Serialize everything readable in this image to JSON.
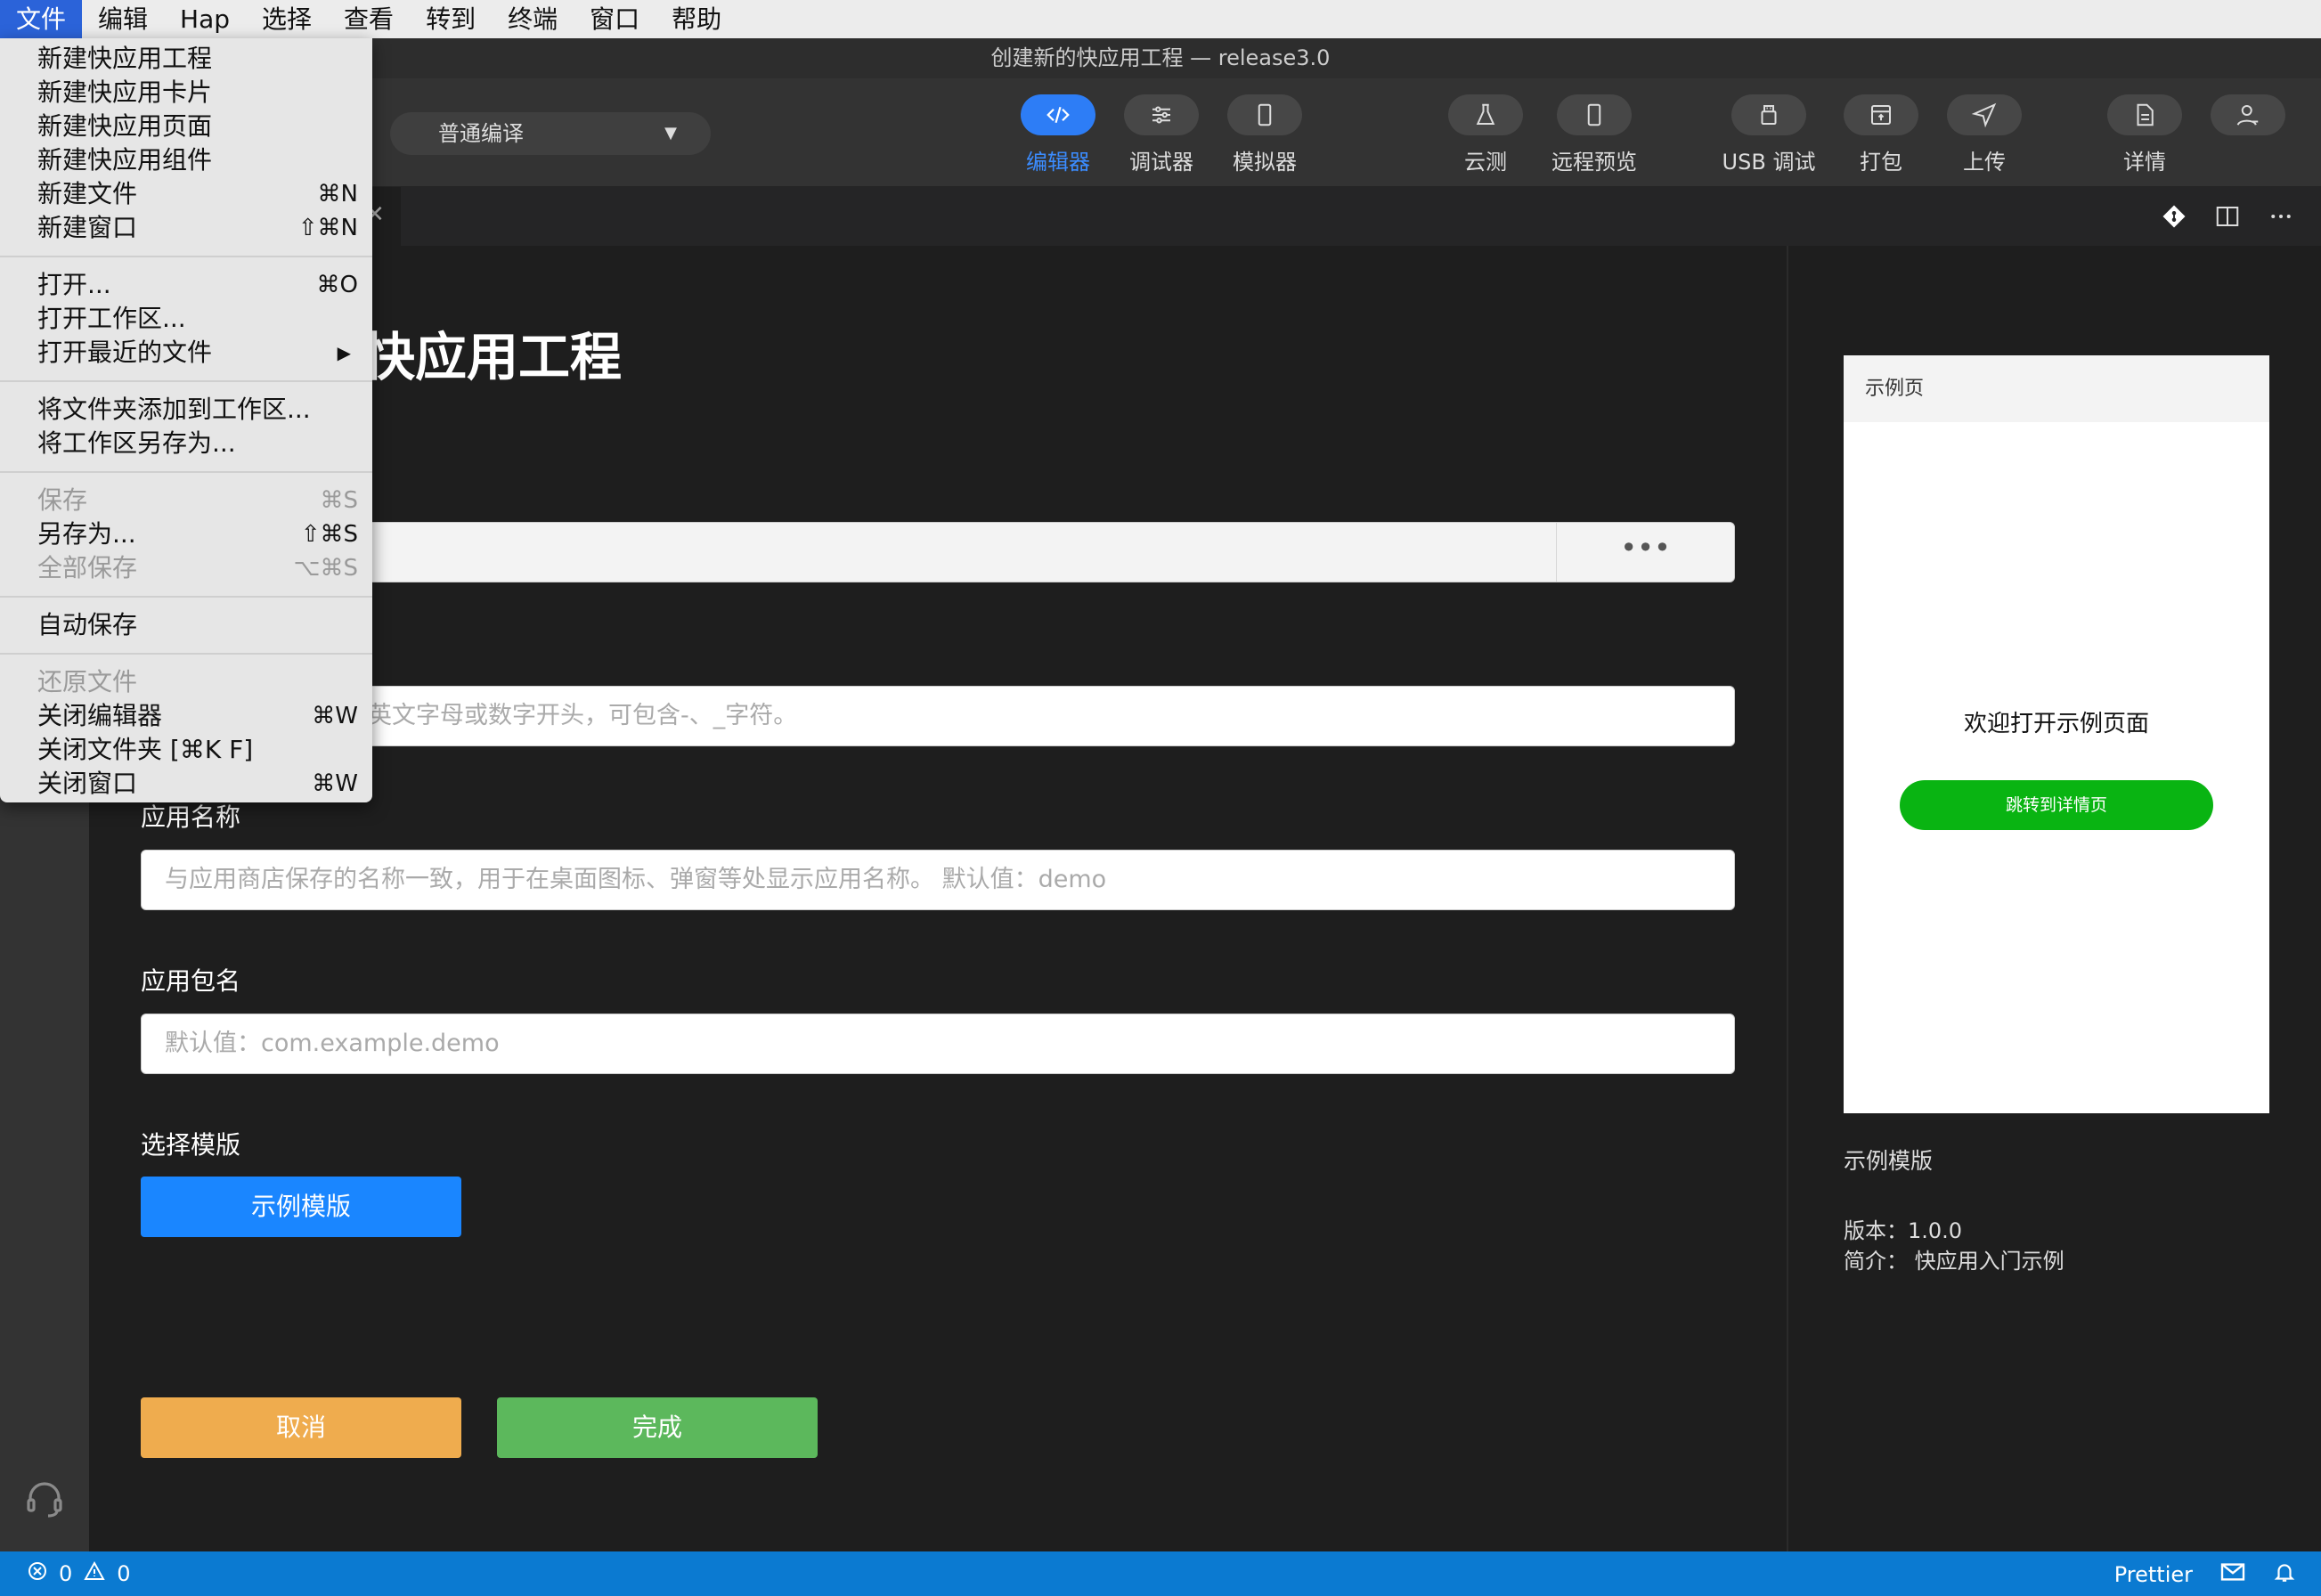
{
  "menubar": {
    "items": [
      "文件",
      "编辑",
      "Hap",
      "选择",
      "查看",
      "转到",
      "终端",
      "窗口",
      "帮助"
    ]
  },
  "window": {
    "title": "创建新的快应用工程 — release3.0"
  },
  "toolbar": {
    "compile_mode": "普通编译",
    "buttons": [
      {
        "label": "编辑器",
        "icon": "code-icon"
      },
      {
        "label": "调试器",
        "icon": "sliders-icon"
      },
      {
        "label": "模拟器",
        "icon": "phone-icon"
      },
      {
        "label": "云测",
        "icon": "flask-icon"
      },
      {
        "label": "远程预览",
        "icon": "phone-icon"
      },
      {
        "label": "USB 调试",
        "icon": "usb-icon"
      },
      {
        "label": "打包",
        "icon": "package-icon"
      },
      {
        "label": "上传",
        "icon": "send-icon"
      },
      {
        "label": "详情",
        "icon": "document-icon"
      }
    ]
  },
  "file_menu": {
    "group1": [
      {
        "label": "新建快应用工程",
        "shortcut": ""
      },
      {
        "label": "新建快应用卡片",
        "shortcut": ""
      },
      {
        "label": "新建快应用页面",
        "shortcut": ""
      },
      {
        "label": "新建快应用组件",
        "shortcut": ""
      },
      {
        "label": "新建文件",
        "shortcut": "⌘N"
      },
      {
        "label": "新建窗口",
        "shortcut": "⇧⌘N"
      }
    ],
    "group2": [
      {
        "label": "打开...",
        "shortcut": "⌘O"
      },
      {
        "label": "打开工作区...",
        "shortcut": ""
      },
      {
        "label": "打开最近的文件",
        "shortcut": ""
      }
    ],
    "group3": [
      {
        "label": "将文件夹添加到工作区...",
        "shortcut": ""
      },
      {
        "label": "将工作区另存为...",
        "shortcut": ""
      }
    ],
    "group4": [
      {
        "label": "保存",
        "shortcut": "⌘S"
      },
      {
        "label": "另存为...",
        "shortcut": "⇧⌘S"
      },
      {
        "label": "全部保存",
        "shortcut": "⌥⌘S"
      }
    ],
    "group5": [
      {
        "label": "自动保存",
        "shortcut": ""
      }
    ],
    "group6": [
      {
        "label": "还原文件",
        "shortcut": ""
      },
      {
        "label": "关闭编辑器",
        "shortcut": "⌘W"
      },
      {
        "label": "关闭文件夹 [⌘K F]",
        "shortcut": ""
      },
      {
        "label": "关闭窗口",
        "shortcut": "⌘W"
      }
    ]
  },
  "form": {
    "title_visible": "快应用工程",
    "path_browse": "•••",
    "name_hint_visible": "英文字母或数字开头，可包含-、_字符。",
    "app_name_label": "应用名称",
    "app_name_placeholder": "与应用商店保存的名称一致，用于在桌面图标、弹窗等处显示应用名称。 默认值：demo",
    "package_label": "应用包名",
    "package_placeholder": "默认值：com.example.demo",
    "template_label": "选择模版",
    "template_button": "示例模版",
    "cancel": "取消",
    "done": "完成"
  },
  "preview": {
    "page_title": "示例页",
    "welcome": "欢迎打开示例页面",
    "jump_button": "跳转到详情页",
    "template_name": "示例模版",
    "version": "版本：1.0.0",
    "intro": "简介：  快应用入门示例"
  },
  "statusbar": {
    "errors": "0",
    "warnings": "0",
    "prettier": "Prettier"
  },
  "colors": {
    "accent": "#1a86ff",
    "cancel": "#efac4e",
    "done": "#5cb85c",
    "statusbar": "#0b7ad1",
    "menu_highlight": "#2b63d9"
  }
}
